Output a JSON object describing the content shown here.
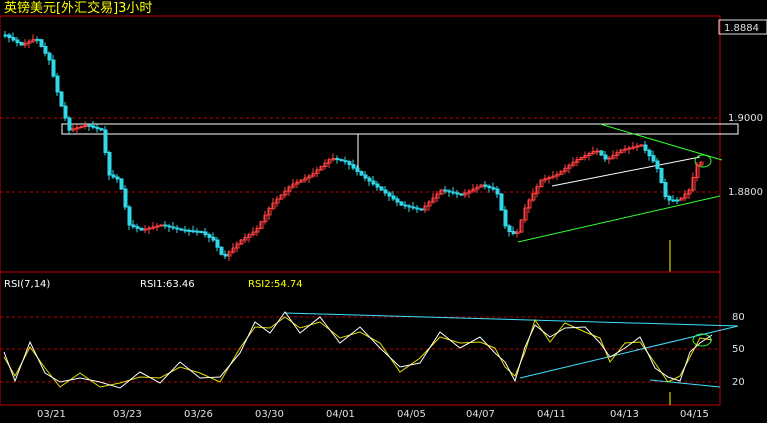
{
  "window": {
    "title": "英镑美元[外汇交易]3小时"
  },
  "price_panel": {
    "axis_labels": {
      "top": "1.8884",
      "upper": "1.9000",
      "lower": "1.8800"
    }
  },
  "rsi_panel": {
    "title": "RSI(7,14)",
    "rsi1_label": "RSI1:63.46",
    "rsi2_label": "RSI2:54.74",
    "axis_labels": [
      "80",
      "50",
      "20"
    ]
  },
  "date_axis": {
    "labels": [
      "03/21",
      "03/23",
      "03/26",
      "03/30",
      "04/01",
      "04/05",
      "04/07",
      "04/11",
      "04/13",
      "04/15"
    ]
  },
  "colors": {
    "background": "#000000",
    "panel_border": "#c00000",
    "grid": "#c00000",
    "up_candle": "#ff4040",
    "down_candle": "#30d8e8",
    "rsi1": "#ffffff",
    "rsi2": "#e8e000",
    "title": "#ffff00",
    "axis_text": "#e0e0e0",
    "trend_green": "#30ff30",
    "trend_white": "#ffffff",
    "trend_cyan": "#40e0ff"
  },
  "chart_data": [
    {
      "type": "candlestick",
      "title": "英镑美元[外汇交易]3小时",
      "x_labels": [
        "03/21",
        "03/23",
        "03/26",
        "03/30",
        "04/01",
        "04/05",
        "04/07",
        "04/11",
        "04/13",
        "04/15"
      ],
      "y_ticks": [
        1.9,
        1.88
      ],
      "last_price": 1.8884,
      "ylim": [
        1.86,
        1.92
      ]
    },
    {
      "type": "line",
      "title": "RSI(7,14)",
      "series": [
        {
          "name": "RSI1",
          "last": 63.46
        },
        {
          "name": "RSI2",
          "last": 54.74
        }
      ],
      "y_ticks": [
        80,
        50,
        20
      ],
      "ylim": [
        0,
        100
      ]
    }
  ]
}
